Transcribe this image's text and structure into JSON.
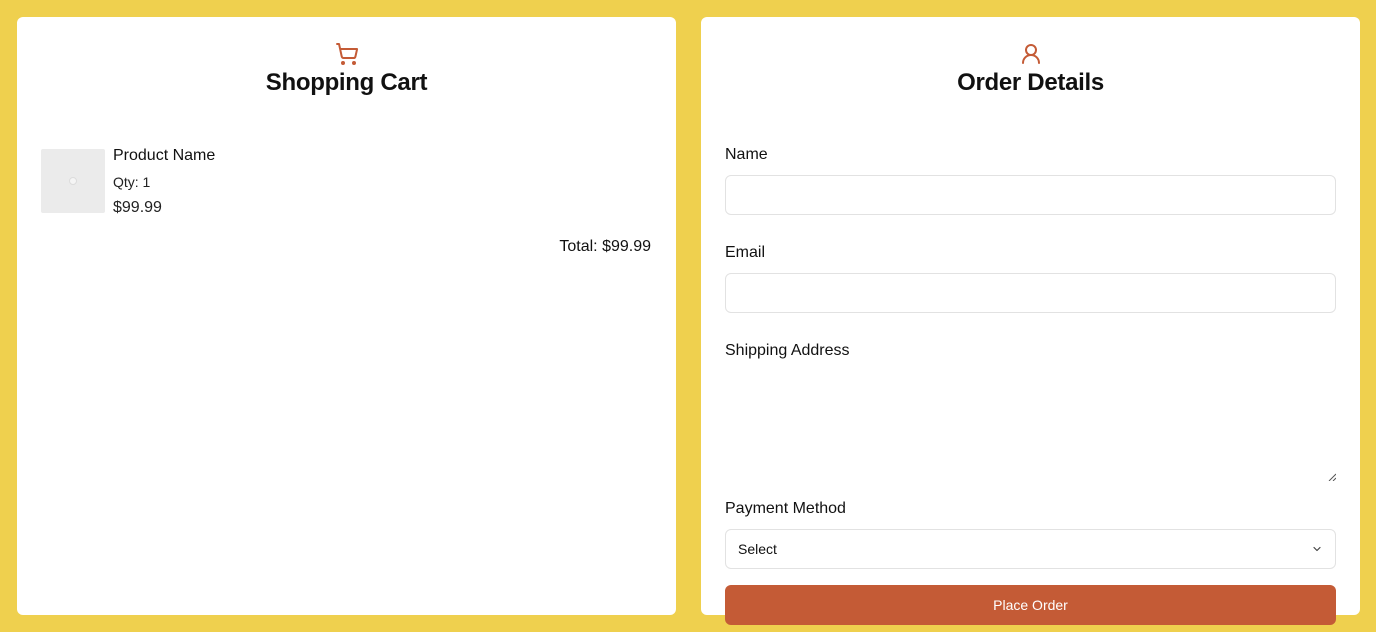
{
  "colors": {
    "background": "#efd04e",
    "panel": "#ffffff",
    "accent": "#c45b36",
    "text": "#111111"
  },
  "cart": {
    "icon": "shopping-cart-icon",
    "title": "Shopping Cart",
    "items": [
      {
        "name": "Product Name",
        "qty": "Qty: 1",
        "price": "$99.99",
        "image_icon": "image-placeholder-icon"
      }
    ],
    "total": "Total: $99.99"
  },
  "order": {
    "icon": "user-icon",
    "title": "Order Details",
    "fields": {
      "name_label": "Name",
      "name_value": "",
      "email_label": "Email",
      "email_value": "",
      "address_label": "Shipping Address",
      "address_value": "",
      "payment_label": "Payment Method",
      "payment_selected": "Select"
    },
    "submit_label": "Place Order"
  }
}
